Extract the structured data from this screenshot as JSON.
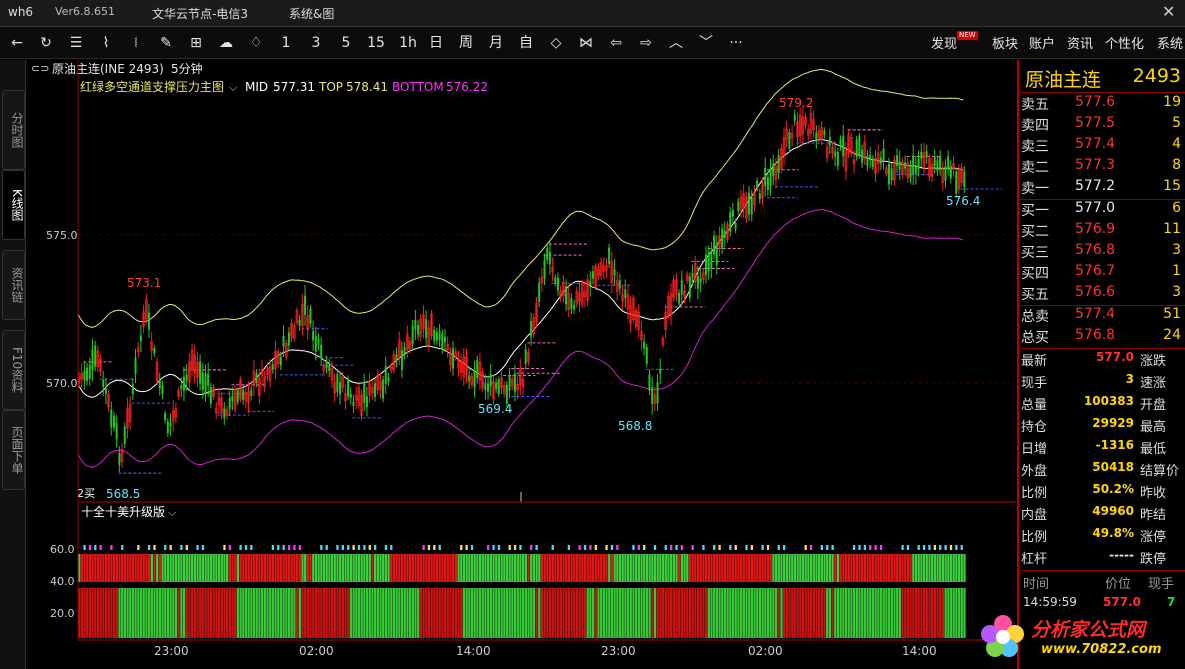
{
  "titlebar": {
    "app_id": "wh6",
    "version": "Ver6.8.651",
    "server": "文华云节点-电信3",
    "menu": "系统&图"
  },
  "toolbar": {
    "periods": [
      "1",
      "3",
      "5",
      "15",
      "1h",
      "日",
      "周",
      "月",
      "自"
    ],
    "right_menu": [
      "发现",
      "板块",
      "账户",
      "资讯",
      "个性化",
      "系统"
    ],
    "new_badge": "NEW"
  },
  "left_tabs": [
    "分时图",
    "K线图",
    "资讯链",
    "F10资料",
    "页面下单"
  ],
  "chart_header": {
    "symbol": "原油主连(INE 2493)",
    "period": "5分钟"
  },
  "main_indicator": {
    "name": "红绿多空通道支撑压力主图",
    "mid_label": "MID",
    "mid_value": "577.31",
    "top_label": "TOP",
    "top_value": "578.41",
    "bottom_label": "BOTTOM",
    "bottom_value": "576.22"
  },
  "price_axis": [
    "575.0",
    "570.0"
  ],
  "price_annotations": [
    "579.2",
    "573.1",
    "569.4",
    "568.8",
    "576.4",
    "568.5"
  ],
  "bottom_tag": "2买 ",
  "sub_indicator": {
    "name": "十全十美升级版",
    "axis": [
      "60.0",
      "40.0",
      "20.0"
    ]
  },
  "time_axis": [
    "23:00",
    "02:00",
    "14:00",
    "23:00",
    "02:00",
    "14:00"
  ],
  "quote_panel": {
    "name": "原油主连",
    "code": "2493",
    "asks": [
      {
        "label": "卖五",
        "price": "577.6",
        "vol": "19"
      },
      {
        "label": "卖四",
        "price": "577.5",
        "vol": "5"
      },
      {
        "label": "卖三",
        "price": "577.4",
        "vol": "4"
      },
      {
        "label": "卖二",
        "price": "577.3",
        "vol": "8"
      },
      {
        "label": "卖一",
        "price": "577.2",
        "vol": "15"
      }
    ],
    "bids": [
      {
        "label": "买一",
        "price": "577.0",
        "vol": "6"
      },
      {
        "label": "买二",
        "price": "576.9",
        "vol": "11"
      },
      {
        "label": "买三",
        "price": "576.8",
        "vol": "3"
      },
      {
        "label": "买四",
        "price": "576.7",
        "vol": "1"
      },
      {
        "label": "买五",
        "price": "576.6",
        "vol": "3"
      }
    ],
    "totals": [
      {
        "label": "总卖",
        "price": "577.4",
        "vol": "51"
      },
      {
        "label": "总买",
        "price": "576.8",
        "vol": "24"
      }
    ],
    "stats": [
      {
        "label": "最新",
        "value": "577.0",
        "right": "涨跌"
      },
      {
        "label": "现手",
        "value": "3",
        "right": "速涨"
      },
      {
        "label": "总量",
        "value": "100383",
        "right": "开盘"
      },
      {
        "label": "持仓",
        "value": "29929",
        "right": "最高"
      },
      {
        "label": "日增",
        "value": "-1316",
        "right": "最低"
      },
      {
        "label": "外盘",
        "value": "50418",
        "right": "结算价"
      },
      {
        "label": "比例",
        "value": "50.2%",
        "right": "昨收"
      },
      {
        "label": "内盘",
        "value": "49960",
        "right": "昨结"
      },
      {
        "label": "比例",
        "value": "49.8%",
        "right": "涨停"
      },
      {
        "label": "杠杆",
        "value": "-----",
        "right": "跌停"
      }
    ],
    "ticks_header": [
      "时间",
      "价位",
      "现手"
    ],
    "tick": {
      "time": "14:59:59",
      "price": "577.0",
      "vol": "7"
    }
  },
  "logo": {
    "text": "分析家公式网",
    "url": "www.70822.com"
  },
  "colors": {
    "up": "#ff2020",
    "down": "#22c822",
    "mid_line": "#ffffff",
    "top_line": "#e8e870",
    "bottom_line": "#d020d0",
    "pink_marker": "#ff66cc",
    "cyan_marker": "#4fd6ff",
    "yellow_marker": "#ffe14d",
    "magenta_marker": "#ff33ff"
  }
}
